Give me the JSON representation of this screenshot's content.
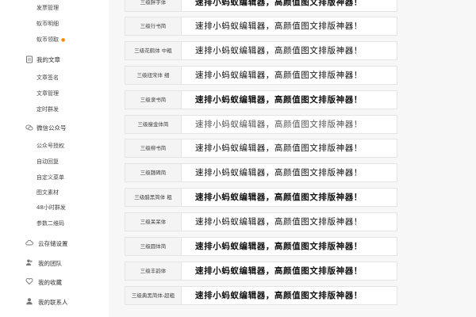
{
  "sidebar": {
    "sub_top": [
      {
        "label": "发票管理",
        "dot": false
      },
      {
        "label": "蚁币明细",
        "dot": false
      },
      {
        "label": "蚁币领取",
        "dot": true
      }
    ],
    "my_articles": {
      "label": "我的文章",
      "items": [
        "文章签名",
        "文章管理",
        "定时群发"
      ]
    },
    "wechat": {
      "label": "微信公众号",
      "items": [
        "公众号授权",
        "自动回复",
        "自定义菜单",
        "图文素材",
        "48小时群发",
        "参数二维码"
      ]
    },
    "bottom_groups": [
      "云存储设置",
      "我的团队",
      "我的收藏",
      "我的联系人"
    ]
  },
  "fonts": [
    {
      "label": "三级胖字体",
      "sample": "速排小蚂蚁编辑器，高颜值图文排版神器！",
      "style": "bold"
    },
    {
      "label": "三级行书简",
      "sample": "速排小蚂蚁编辑器，高颜值图文排版神器！",
      "style": "serif"
    },
    {
      "label": "三级花鹤体 中粗",
      "sample": "速排小蚂蚁编辑器，高颜值图文排版神器！",
      "style": "serif"
    },
    {
      "label": "三级扭宋体 细",
      "sample": "速排小蚂蚁编辑器，高颜值图文排版神器！",
      "style": "normal"
    },
    {
      "label": "三级隶书简",
      "sample": "速排小蚂蚁编辑器，高颜值图文排版神器！",
      "style": "bold"
    },
    {
      "label": "三级瘦金体简",
      "sample": "速排小蚂蚁编辑器，高颜值图文排版神器！",
      "style": "light"
    },
    {
      "label": "三级柳书简",
      "sample": "速排小蚂蚁编辑器，高颜值图文排版神器！",
      "style": "serif"
    },
    {
      "label": "三级魏碑简",
      "sample": "速排小蚂蚁编辑器，高颜值图文排版神器！",
      "style": "serif"
    },
    {
      "label": "三级醋黑简体 粗",
      "sample": "速排小蚂蚁编辑器，高颜值图文排版神器！",
      "style": "bold"
    },
    {
      "label": "三级呆呆体",
      "sample": "速排小蚂蚁编辑器，高颜值图文排版神器！",
      "style": "normal"
    },
    {
      "label": "三级圆体简",
      "sample": "速排小蚂蚁编辑器，高颜值图文排版神器！",
      "style": "bold"
    },
    {
      "label": "三级丰韵体",
      "sample": "速排小蚂蚁编辑器，高颜值图文排版神器！",
      "style": "bold"
    },
    {
      "label": "三级典黑简体-超粗",
      "sample": "速排小蚂蚁编辑器，高颜值图文排版神器！",
      "style": "bold"
    }
  ],
  "icons": {
    "my_articles": "document-icon",
    "wechat": "chat-bubble-icon",
    "cloud": "cloud-icon",
    "team": "people-icon",
    "favorites": "heart-icon",
    "contacts": "contacts-icon"
  },
  "colors": {
    "dot": "#ff8a00"
  }
}
